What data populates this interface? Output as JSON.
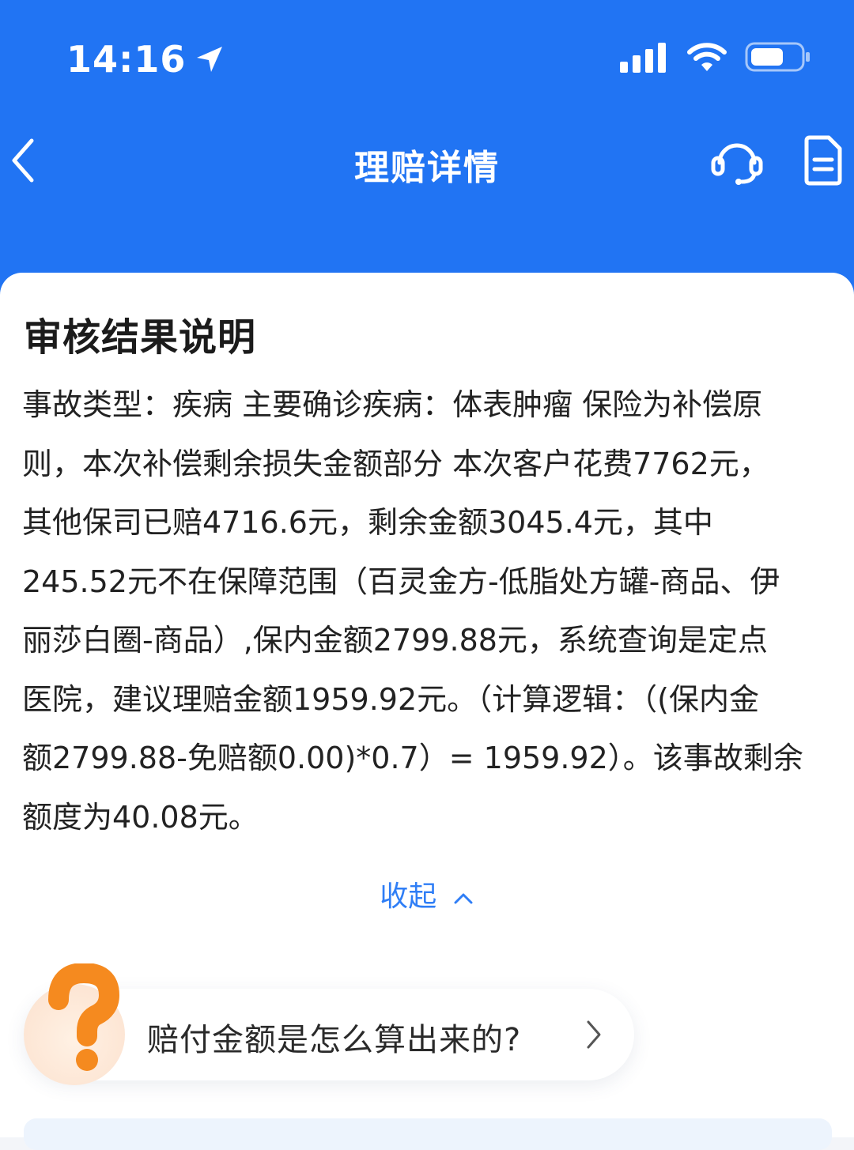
{
  "status_bar": {
    "time": "14:16"
  },
  "nav": {
    "title": "理赔详情"
  },
  "card": {
    "title": "审核结果说明",
    "body_lines": [
      "事故类型：疾病 主要确诊疾病：体表肿瘤 保险为补偿原",
      "则，本次补偿剩余损失金额部分 本次客户花费7762元，",
      "其他保司已赔4716.6元，剩余金额3045.4元，其中",
      "245.52元不在保障范围（百灵金方-低脂处方罐-商品、伊",
      "丽莎白圈-商品）,保内金额2799.88元，系统查询是定点",
      "医院，建议理赔金额1959.92元。（计算逻辑：（(保内金",
      "额2799.88-免赔额0.00)*0.7）= 1959.92）。该事故剩余",
      "额度为40.08元。"
    ],
    "collapse_label": "收起"
  },
  "faq": {
    "question": "赔付金额是怎么算出来的?"
  },
  "colors": {
    "brand_blue": "#2174f3",
    "link_blue": "#2f7ef6",
    "faq_orange": "#f58a1f"
  },
  "icons": [
    "location-arrow-icon",
    "cellular-signal-icon",
    "wifi-icon",
    "battery-icon",
    "back-chevron-icon",
    "customer-service-icon",
    "document-icon",
    "chevron-up-icon",
    "question-mark-icon",
    "chevron-right-icon"
  ]
}
